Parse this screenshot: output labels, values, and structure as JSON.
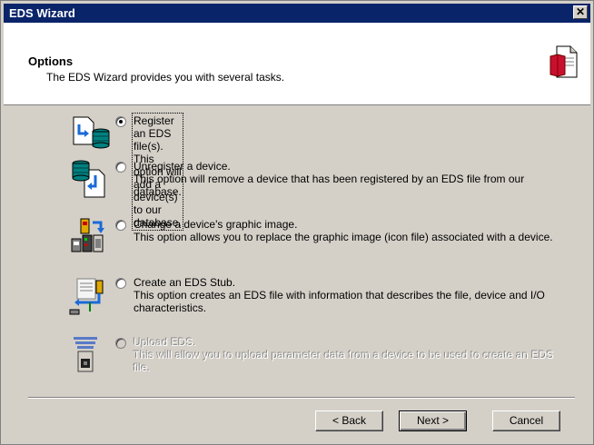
{
  "window": {
    "title": "EDS Wizard",
    "close_glyph": "✕"
  },
  "header": {
    "title": "Options",
    "subtitle": "The EDS Wizard provides you with several tasks.",
    "icon": "document-icon"
  },
  "options": [
    {
      "line1": "Register an EDS file(s).",
      "line2": "This option will add a device(s) to our database.",
      "icon": "register-eds-icon",
      "selected": true,
      "enabled": true
    },
    {
      "line1": "Unregister a device.",
      "line2": "This option will remove a device that has been registered by an EDS file from our database.",
      "icon": "unregister-device-icon",
      "selected": false,
      "enabled": true
    },
    {
      "line1": "Change a device's graphic image.",
      "line2": "This option allows you to replace the graphic image (icon file) associated with a device.",
      "icon": "change-image-icon",
      "selected": false,
      "enabled": true
    },
    {
      "line1": "Create an EDS Stub.",
      "line2": "This option creates an EDS file with information that describes the file, device and I/O characteristics.",
      "icon": "create-stub-icon",
      "selected": false,
      "enabled": true
    },
    {
      "line1": "Upload EDS.",
      "line2": "This will allow you to upload parameter data from a device to be used to create an EDS file.",
      "icon": "upload-eds-icon",
      "selected": false,
      "enabled": false
    }
  ],
  "buttons": {
    "back": "< Back",
    "next": "Next >",
    "cancel": "Cancel"
  },
  "colors": {
    "titlebar": "#0a246a",
    "face": "#d4d0c8",
    "header_bg": "#ffffff"
  }
}
